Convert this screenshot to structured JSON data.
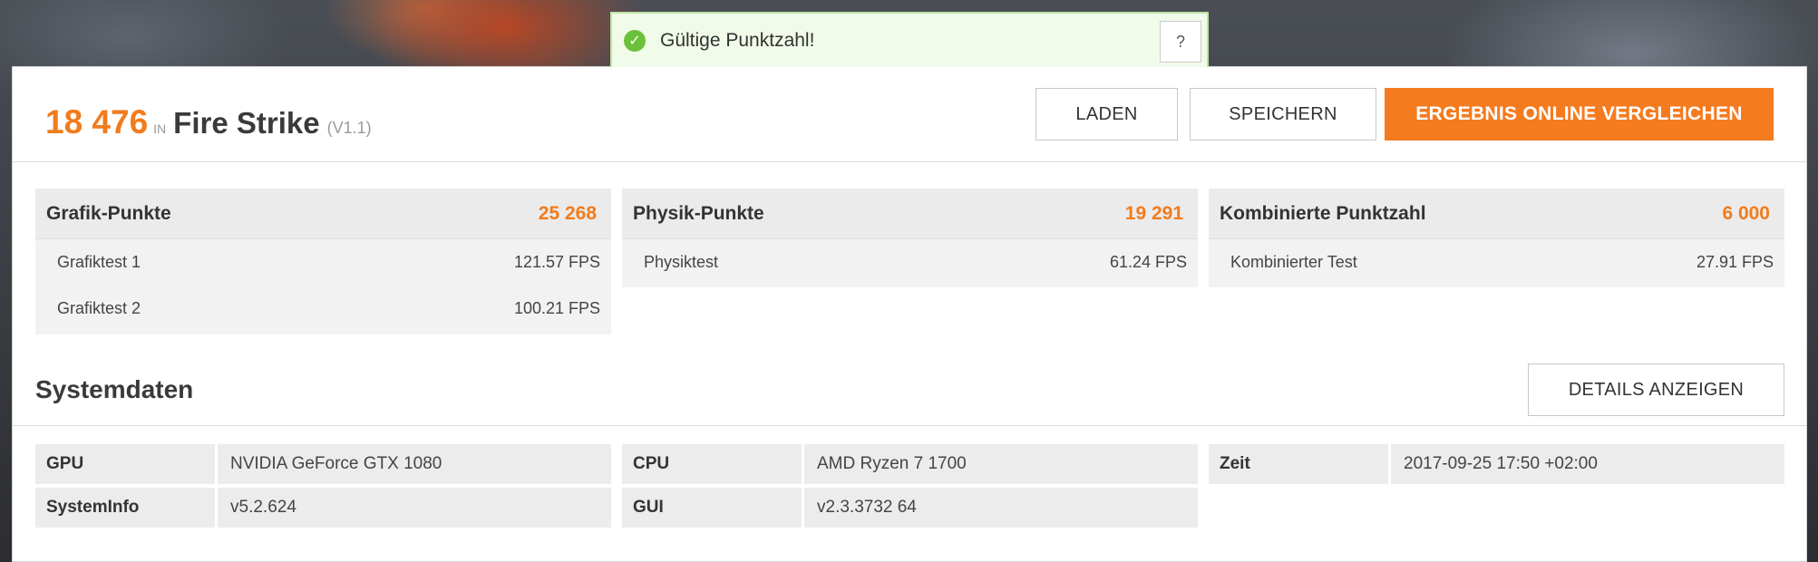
{
  "toast": {
    "message": "Gültige Punktzahl!",
    "help_label": "?"
  },
  "header": {
    "score": "18 476",
    "in_label": "IN",
    "benchmark": "Fire Strike",
    "version": "(V1.1)",
    "load_label": "LADEN",
    "save_label": "SPEICHERN",
    "compare_label": "ERGEBNIS ONLINE VERGLEICHEN"
  },
  "cards": [
    {
      "title": "Grafik-Punkte",
      "score": "25 268",
      "rows": [
        {
          "label": "Grafiktest 1",
          "value": "121.57 FPS"
        },
        {
          "label": "Grafiktest 2",
          "value": "100.21 FPS"
        }
      ]
    },
    {
      "title": "Physik-Punkte",
      "score": "19 291",
      "rows": [
        {
          "label": "Physiktest",
          "value": "61.24 FPS"
        }
      ]
    },
    {
      "title": "Kombinierte Punktzahl",
      "score": "6 000",
      "rows": [
        {
          "label": "Kombinierter Test",
          "value": "27.91 FPS"
        }
      ]
    }
  ],
  "system": {
    "title": "Systemdaten",
    "details_label": "DETAILS ANZEIGEN",
    "columns": [
      [
        {
          "key": "GPU",
          "value": "NVIDIA GeForce GTX 1080"
        },
        {
          "key": "SystemInfo",
          "value": "v5.2.624"
        }
      ],
      [
        {
          "key": "CPU",
          "value": "AMD Ryzen 7 1700"
        },
        {
          "key": "GUI",
          "value": "v2.3.3732 64"
        }
      ],
      [
        {
          "key": "Zeit",
          "value": "2017-09-25 17:50 +02:00"
        }
      ]
    ]
  },
  "colors": {
    "accent": "#f27b1b",
    "valid_green": "#6cc13a"
  }
}
